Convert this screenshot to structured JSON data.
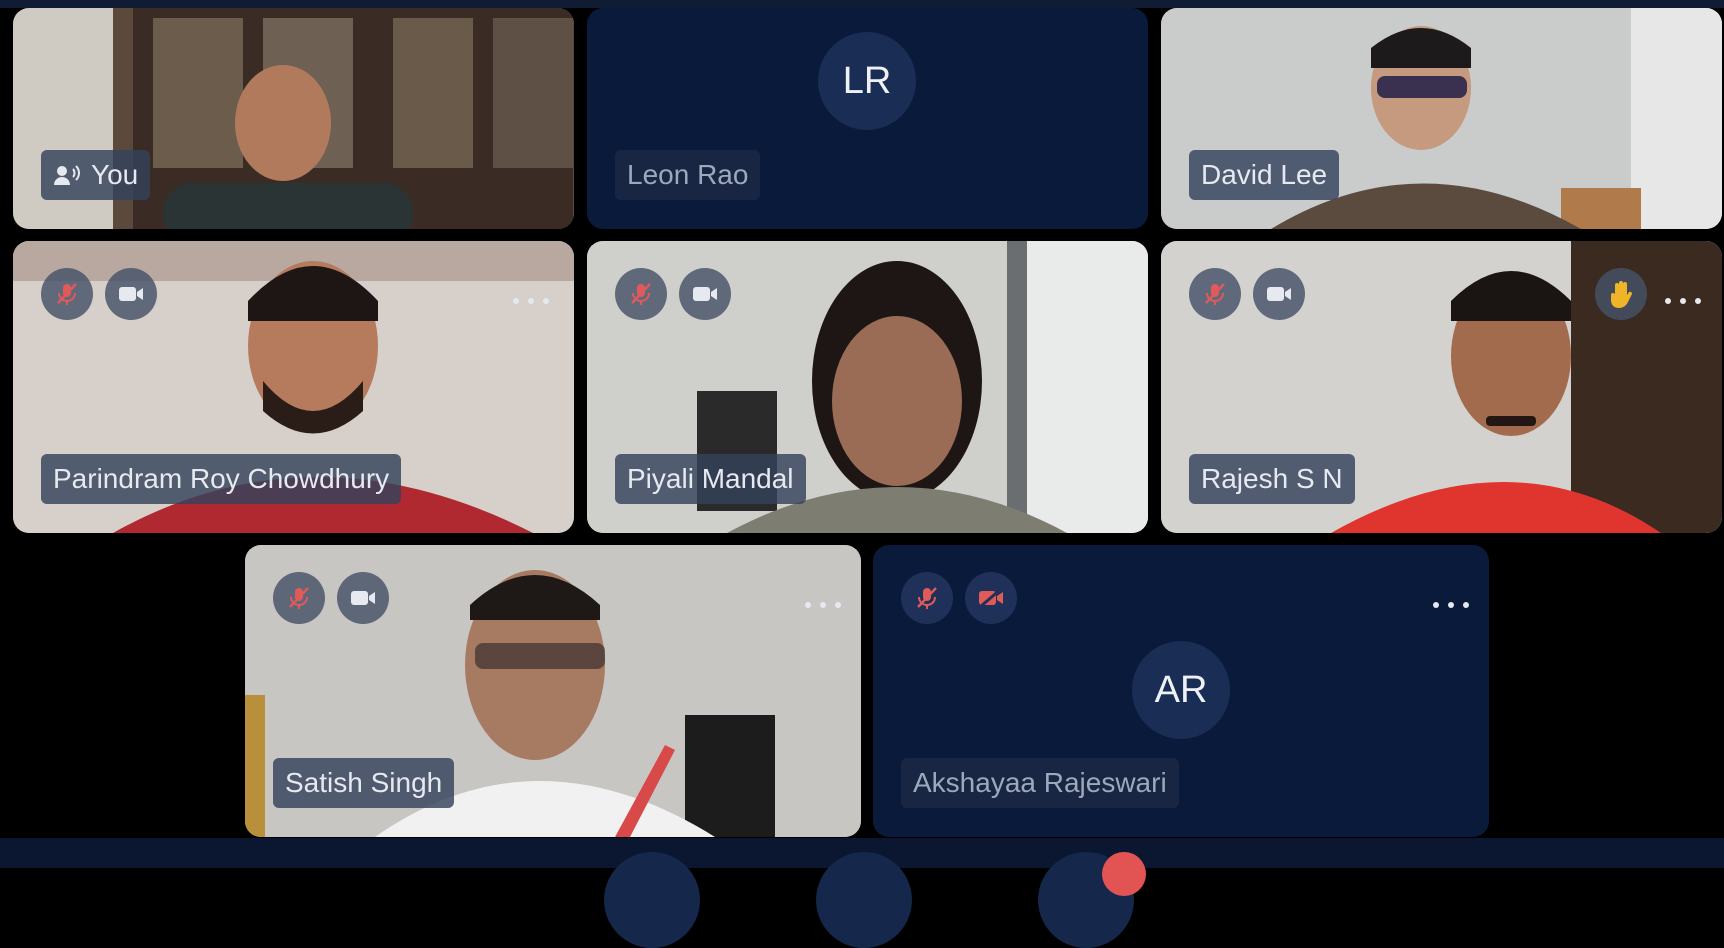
{
  "participants": [
    {
      "name": "You",
      "type": "video",
      "speaking": true
    },
    {
      "name": "Leon Rao",
      "type": "avatar",
      "initials": "LR"
    },
    {
      "name": "David Lee",
      "type": "video"
    },
    {
      "name": "Parindram Roy Chowdhury",
      "type": "video",
      "mic": "muted",
      "camera": "on"
    },
    {
      "name": "Piyali Mandal",
      "type": "video",
      "mic": "muted",
      "camera": "on"
    },
    {
      "name": "Rajesh S N",
      "type": "video",
      "mic": "muted",
      "camera": "on",
      "hand_raised": true
    },
    {
      "name": "Satish Singh",
      "type": "video",
      "mic": "muted",
      "camera": "on"
    },
    {
      "name": "Akshayaa Rajeswari",
      "type": "avatar",
      "initials": "AR",
      "mic": "muted",
      "camera": "off"
    }
  ],
  "icons": {
    "mic_muted": "mic-muted-icon",
    "camera_on": "camera-icon",
    "camera_off": "camera-off-icon",
    "more": "more-options-icon",
    "hand": "raise-hand-icon",
    "speaker": "speaking-icon"
  },
  "colors": {
    "tile_bg": "#0a1a3a",
    "avatar_bg": "#1a2d55",
    "muted_red": "#e05a5a",
    "hand_yellow": "#f0b429"
  }
}
